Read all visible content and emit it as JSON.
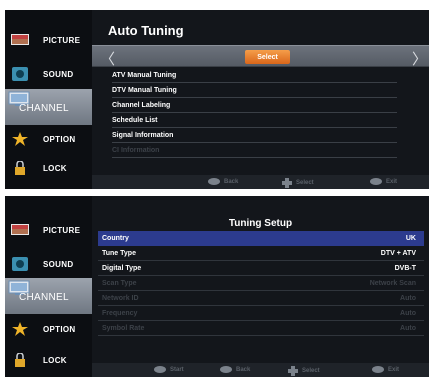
{
  "sidebar": {
    "items": [
      {
        "label": "PICTURE",
        "icon": "picture-icon"
      },
      {
        "label": "SOUND",
        "icon": "sound-icon"
      },
      {
        "label": "CHANNEL",
        "icon": "channel-icon"
      },
      {
        "label": "OPTION",
        "icon": "option-icon"
      },
      {
        "label": "LOCK",
        "icon": "lock-icon"
      }
    ],
    "active": "CHANNEL"
  },
  "auto_tuning": {
    "title": "Auto Tuning",
    "select_label": "Select",
    "left_arrow": "〈",
    "right_arrow": "〉",
    "items": [
      "ATV Manual Tuning",
      "DTV Manual Tuning",
      "Channel Labeling",
      "Schedule List",
      "Signal Information",
      "CI Information"
    ],
    "footer": {
      "back": "Back",
      "select": "Select",
      "exit": "Exit"
    }
  },
  "tuning_setup": {
    "title": "Tuning Setup",
    "rows": [
      {
        "label": "Country",
        "value": "UK"
      },
      {
        "label": "Tune Type",
        "value": "DTV + ATV"
      },
      {
        "label": "Digital Type",
        "value": "DVB-T"
      },
      {
        "label": "Scan Type",
        "value": "Network Scan"
      },
      {
        "label": "Network ID",
        "value": "Auto"
      },
      {
        "label": "Frequency",
        "value": "Auto"
      },
      {
        "label": "Symbol Rate",
        "value": "Auto"
      }
    ],
    "footer": {
      "start": "Start",
      "back": "Back",
      "select": "Select",
      "exit": "Exit"
    }
  },
  "colors": {
    "highlight": "#2c3b8e",
    "select_button": "#e67e2c",
    "active_sidebar": "#8e95a0"
  }
}
